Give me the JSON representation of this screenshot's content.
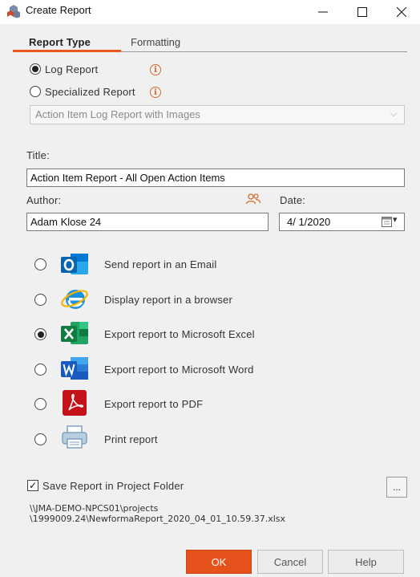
{
  "window": {
    "title": "Create Report",
    "controls": {
      "minimize": "—",
      "maximize": "☐",
      "close": "✕"
    }
  },
  "tabs": [
    {
      "label": "Report Type",
      "active": true
    },
    {
      "label": "Formatting",
      "active": false
    }
  ],
  "report_kind": {
    "options": [
      {
        "label": "Log Report",
        "selected": true,
        "icon": "info-icon"
      },
      {
        "label": "Specialized Report",
        "selected": false,
        "icon": "info-icon"
      }
    ],
    "info_glyph": "i",
    "specialized_dropdown": {
      "value": "Action Item Log Report with Images",
      "arrow": "⌵"
    }
  },
  "title_field": {
    "label": "Title:",
    "value": "Action Item Report - All Open Action Items"
  },
  "author_field": {
    "label": "Author:",
    "value": "Adam Klose 24",
    "icon": "people-icon"
  },
  "date_field": {
    "label": "Date:",
    "value": "4/  1/2020",
    "icon": "calendar-icon",
    "arrow": "▾"
  },
  "output_options": [
    {
      "label": "Send report in an Email",
      "selected": false,
      "icon": "outlook-icon"
    },
    {
      "label": "Display report in a browser",
      "selected": false,
      "icon": "internet-explorer-icon"
    },
    {
      "label": "Export report to Microsoft Excel",
      "selected": true,
      "icon": "excel-icon"
    },
    {
      "label": "Export report to Microsoft Word",
      "selected": false,
      "icon": "word-icon"
    },
    {
      "label": "Export report to PDF",
      "selected": false,
      "icon": "pdf-icon"
    },
    {
      "label": "Print report",
      "selected": false,
      "icon": "printer-icon"
    }
  ],
  "save_folder": {
    "label": "Save Report in Project Folder",
    "checked": true,
    "check_glyph": "✓",
    "browse_label": "...",
    "path_line1": "\\\\JMA-DEMO-NPCS01\\projects",
    "path_line2": "\\1999009.24\\NewformaReport_2020_04_01_10.59.37.xlsx"
  },
  "buttons": {
    "ok": "OK",
    "cancel": "Cancel",
    "help": "Help"
  },
  "colors": {
    "accent": "#e5521c",
    "background": "#f0f0f0",
    "info": "#d46b2a"
  }
}
